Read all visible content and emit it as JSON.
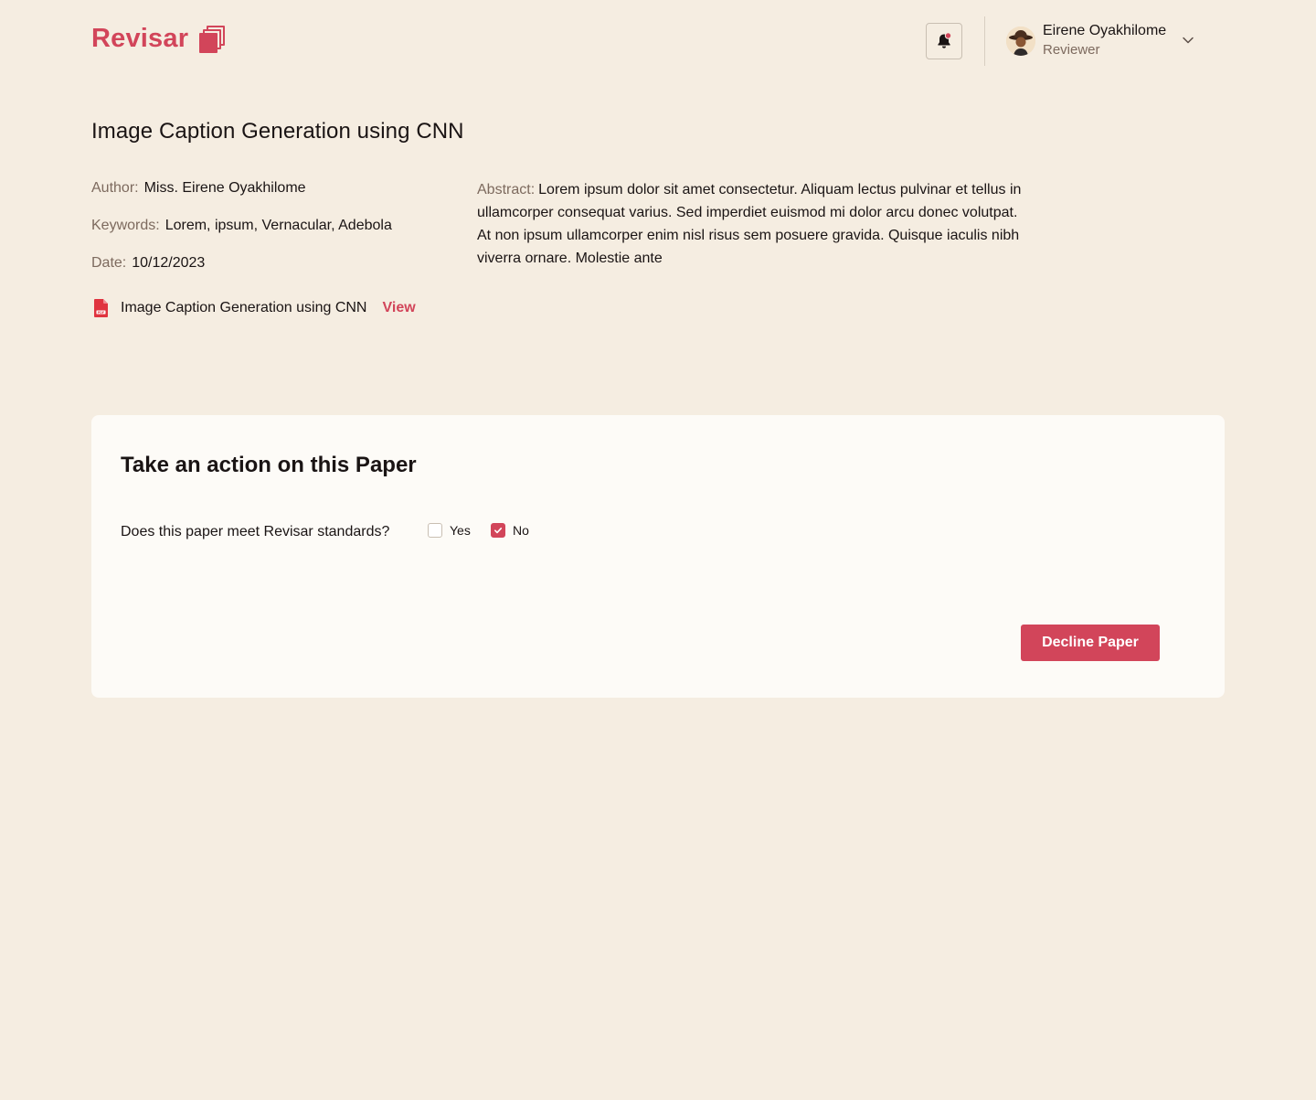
{
  "app": {
    "name": "Revisar",
    "brand_color": "#D2455A",
    "background_color": "#F5EDE1"
  },
  "header": {
    "notification_icon": "bell-icon",
    "user": {
      "name": "Eirene Oyakhilome",
      "role": "Reviewer",
      "avatar_icon": "avatar-icon"
    },
    "menu_icon": "chevron-down-icon"
  },
  "paper": {
    "title": "Image Caption Generation using CNN",
    "author_label": "Author:",
    "author": "Miss. Eirene Oyakhilome",
    "keywords_label": "Keywords:",
    "keywords": "Lorem, ipsum, Vernacular, Adebola",
    "date_label": "Date:",
    "date": "10/12/2023",
    "abstract_label": "Abstract:",
    "abstract": "Lorem ipsum dolor sit amet consectetur. Aliquam lectus pulvinar et tellus in ullamcorper consequat varius. Sed imperdiet euismod mi dolor arcu donec volutpat. At non ipsum ullamcorper enim nisl risus sem posuere gravida. Quisque iaculis nibh viverra ornare. Molestie ante",
    "file": {
      "icon": "pdf-file-icon",
      "name": "Image Caption Generation using CNN",
      "view_label": "View"
    }
  },
  "action_card": {
    "title": "Take an action on this Paper",
    "question": "Does this paper meet Revisar standards?",
    "options": [
      {
        "label": "Yes",
        "checked": false
      },
      {
        "label": "No",
        "checked": true
      }
    ],
    "decline_label": "Decline Paper"
  }
}
